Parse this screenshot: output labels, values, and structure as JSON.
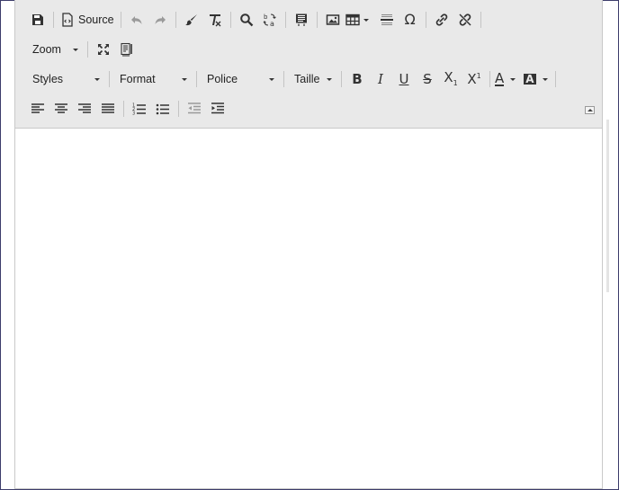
{
  "toolbar": {
    "source_label": "Source",
    "zoom_label": "Zoom",
    "styles_label": "Styles",
    "format_label": "Format",
    "font_label": "Police",
    "size_label": "Taille"
  },
  "icons": {
    "save": "save-icon",
    "source": "source-icon",
    "undo": "undo-icon",
    "redo": "redo-icon",
    "copy_format": "paintbrush-icon",
    "remove_format": "clear-format-icon",
    "find": "search-icon",
    "replace": "replace-icon",
    "template": "template-icon",
    "image": "image-icon",
    "table": "table-icon",
    "hr": "horizontal-line-icon",
    "special_char": "omega-icon",
    "link": "link-icon",
    "unlink": "unlink-icon",
    "maximize": "maximize-icon",
    "show_blocks": "show-blocks-icon",
    "bold": "bold-icon",
    "italic": "italic-icon",
    "underline": "underline-icon",
    "strike": "strikethrough-icon",
    "subscript": "subscript-icon",
    "superscript": "superscript-icon",
    "text_color": "text-color-icon",
    "bg_color": "background-color-icon",
    "align_left": "align-left-icon",
    "align_center": "align-center-icon",
    "align_right": "align-right-icon",
    "align_justify": "align-justify-icon",
    "ordered_list": "numbered-list-icon",
    "bullet_list": "bulleted-list-icon",
    "outdent": "outdent-icon",
    "indent": "indent-icon",
    "collapse": "collapse-toolbar-icon"
  },
  "colors": {
    "toolbar_bg": "#e9e9e9",
    "border": "#c9c9c9",
    "frame": "#3d3d6b",
    "disabled": "#9a9a9a"
  }
}
